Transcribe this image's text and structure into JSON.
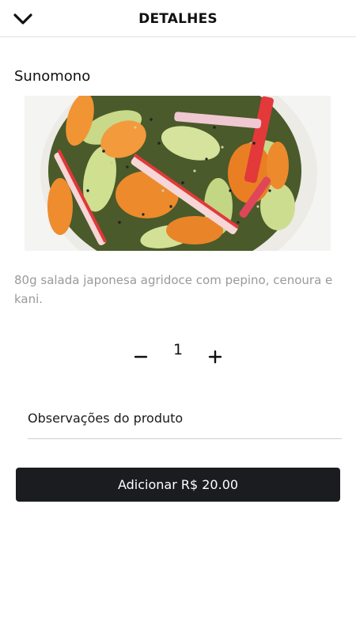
{
  "header": {
    "title": "DETALHES",
    "back_icon": "chevron-down-icon"
  },
  "product": {
    "name": "Sunomono",
    "description": "80g salada japonesa agridoce com pepino, cenoura e kani.",
    "image_icon": "salad-bowl-image"
  },
  "quantity": {
    "minus_icon": "minus-icon",
    "value": "1",
    "plus_icon": "plus-icon"
  },
  "notes": {
    "placeholder": "Observações do produto",
    "value": ""
  },
  "add_button": {
    "label": "Adicionar R$ 20.00"
  },
  "colors": {
    "button_background": "#1b1c20",
    "description_text": "#9a9a9a",
    "divider": "#e2e2e2"
  }
}
